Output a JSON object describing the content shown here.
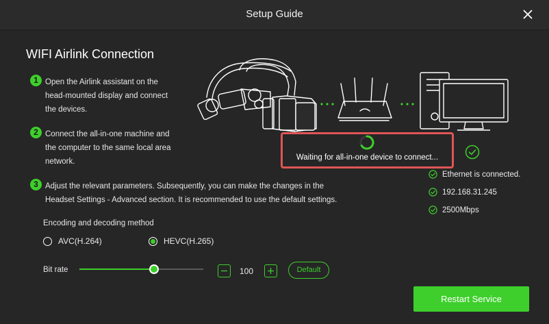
{
  "window": {
    "title": "Setup Guide"
  },
  "main": {
    "heading": "WIFI Airlink Connection",
    "steps": [
      {
        "num": "1",
        "lines": [
          "Open the Airlink assistant on the",
          "head-mounted display and connect",
          "the devices."
        ]
      },
      {
        "num": "2",
        "lines": [
          "Connect the all-in-one machine and",
          "the computer to the same local area",
          "network."
        ]
      },
      {
        "num": "3",
        "lines": [
          "Adjust the relevant parameters. Subsequently, you can make the changes in the",
          "Headset Settings - Advanced section. It is recommended to use the default settings."
        ]
      }
    ],
    "encoding": {
      "label": "Encoding and decoding method",
      "options": [
        {
          "label": "AVC(H.264)",
          "selected": false
        },
        {
          "label": "HEVC(H.265)",
          "selected": true
        }
      ]
    },
    "bitrate": {
      "label": "Bit rate",
      "value": "100",
      "slider_fraction": 0.6,
      "default_label": "Default"
    },
    "restart_label": "Restart Service"
  },
  "connection": {
    "waiting_text": "Waiting for all-in-one device to connect...",
    "statuses": [
      "Ethernet is connected.",
      "192.168.31.245",
      "2500Mbps"
    ]
  },
  "colors": {
    "accent": "#3ecf2c",
    "highlight_border": "#e05555",
    "background": "#262626"
  },
  "icons": {
    "close": "close-icon",
    "spinner": "loading-spinner-icon",
    "check": "check-circle-icon"
  }
}
